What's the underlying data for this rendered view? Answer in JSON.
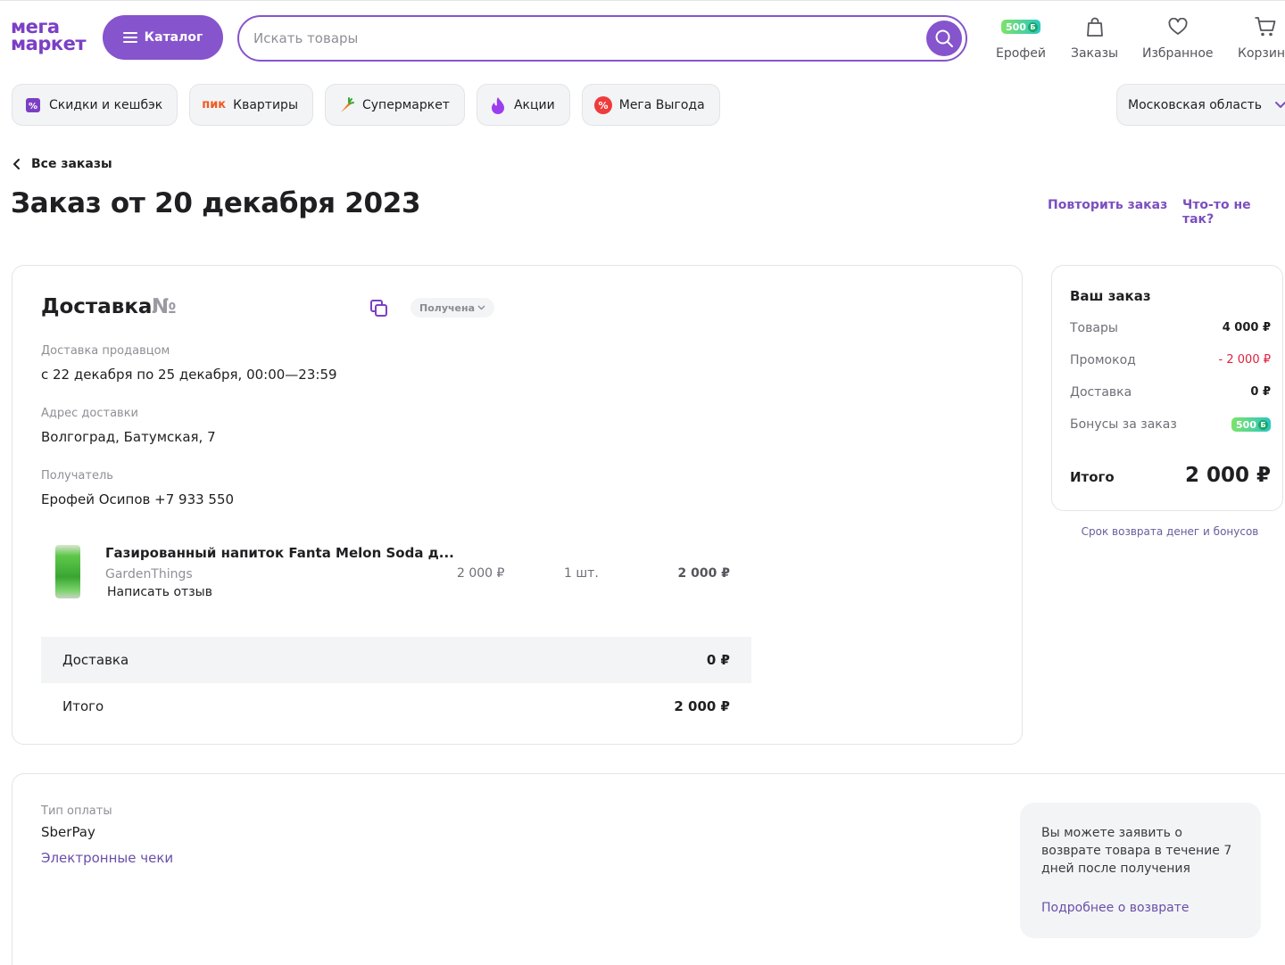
{
  "header": {
    "logo_top": "мега",
    "logo_bottom": "маркет",
    "catalog_label": "Каталог",
    "search_placeholder": "Искать товары",
    "bonus_amount": "500",
    "user_label": "Ерофей",
    "orders_label": "Заказы",
    "favorites_label": "Избранное",
    "cart_label": "Корзина"
  },
  "chips": [
    {
      "label": "Скидки и кешбэк",
      "icon": "percent-badge-icon"
    },
    {
      "prefix": "пик",
      "label": "Квартиры",
      "icon": "pik-logo"
    },
    {
      "label": "Супермаркет",
      "icon": "carrot-icon"
    },
    {
      "label": "Акции",
      "icon": "flame-icon"
    },
    {
      "label": "Мега Выгода",
      "icon": "percent-circle-icon"
    }
  ],
  "region": "Московская область",
  "breadcrumb": "Все заказы",
  "title": "Заказ от 20 декабря 2023",
  "actions": {
    "repeat": "Повторить заказ",
    "problem": "Что-то не так?"
  },
  "delivery": {
    "title": "Доставка",
    "number_sign": "№",
    "status": "Получена",
    "method_label": "Доставка продавцом",
    "method_value": "с 22 декабря по 25 декабря, 00:00—23:59",
    "address_label": "Адрес доставки",
    "address_value": "Волгоград, Батумская, 7",
    "recipient_label": "Получатель",
    "recipient_value": "Ерофей Осипов +7 933 550"
  },
  "product": {
    "name": "Газированный напиток Fanta Melon Soda д...",
    "seller": "GardenThings",
    "review": "Написать отзыв",
    "price": "2 000 ₽",
    "qty": "1 шт.",
    "total": "2 000 ₽"
  },
  "card_totals": {
    "delivery_label": "Доставка",
    "delivery_value": "0 ₽",
    "total_label": "Итого",
    "total_value": "2 000 ₽"
  },
  "summary": {
    "title": "Ваш заказ",
    "goods_label": "Товары",
    "goods_value": "4 000 ₽",
    "promo_label": "Промокод",
    "promo_value": "- 2 000 ₽",
    "delivery_label": "Доставка",
    "delivery_value": "0 ₽",
    "bonus_label": "Бонусы за заказ",
    "bonus_value": "500",
    "total_label": "Итого",
    "total_value": "2 000 ₽",
    "refund_term": "Срок возврата денег и бонусов"
  },
  "payment": {
    "label": "Тип оплаты",
    "value": "SberPay",
    "receipts": "Электронные чеки",
    "info_text": "Вы можете заявить о возврате товара в течение 7 дней после получения",
    "info_link": "Подробнее о возврате"
  },
  "colors": {
    "accent": "#8654cc",
    "promo_red": "#e0213f"
  }
}
